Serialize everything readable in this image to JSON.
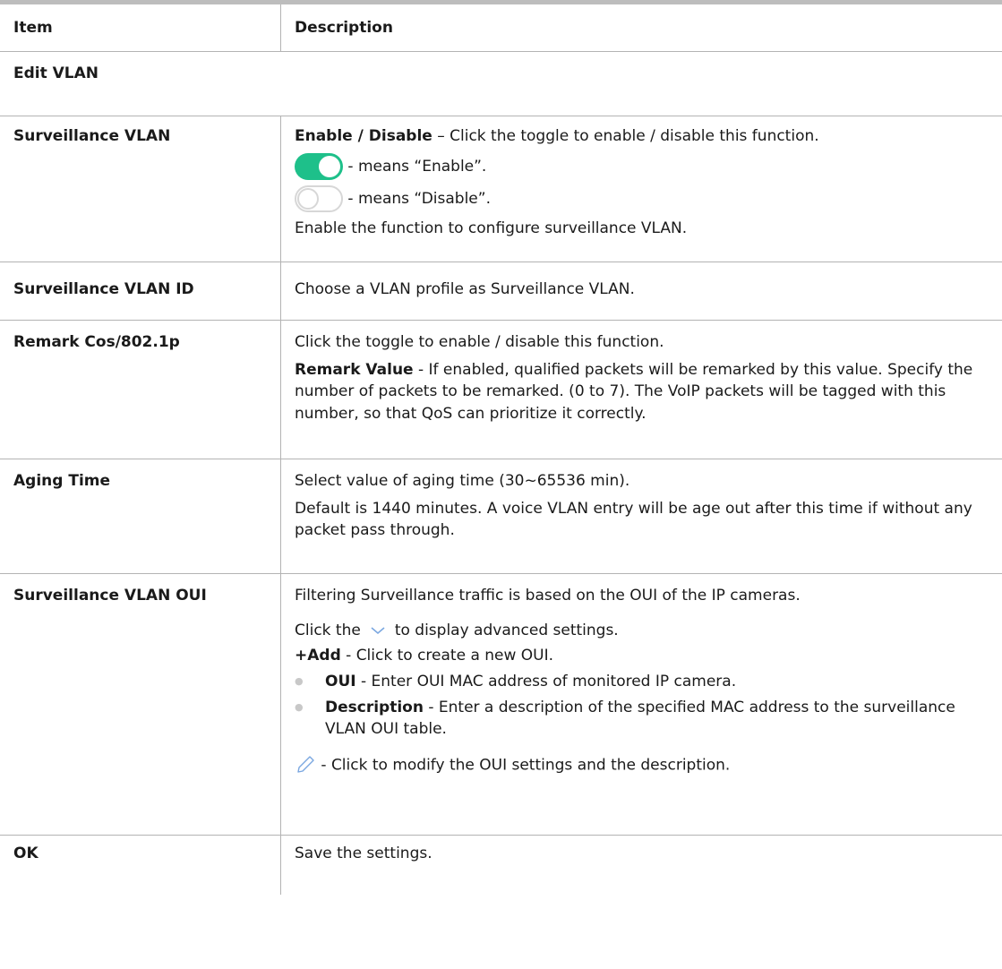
{
  "header": {
    "item": "Item",
    "description": "Description"
  },
  "section": {
    "title": "Edit VLAN"
  },
  "rows": {
    "surveillance_vlan": {
      "item": "Surveillance VLAN",
      "line1_bold": "Enable / Disable",
      "line1_rest": " – Click the toggle to enable / disable this function.",
      "enable_text": " - means “Enable”.",
      "disable_text": " - means “Disable”.",
      "line4": "Enable the function to configure surveillance VLAN."
    },
    "surveillance_vlan_id": {
      "item": "Surveillance VLAN ID",
      "text": "Choose a VLAN profile as Surveillance VLAN."
    },
    "remark": {
      "item": "Remark Cos/802.1p",
      "line1": "Click the toggle to enable / disable this function.",
      "bold": "Remark Value",
      "rest": " - If enabled, qualified packets will be remarked by this value. Specify the number of packets to be remarked. (0 to 7). The VoIP packets will be tagged with this number, so that QoS can prioritize it correctly."
    },
    "aging_time": {
      "item": "Aging Time",
      "line1": "Select value of aging time (30~65536 min).",
      "line2": "Default is 1440 minutes. A voice VLAN entry will be age out after this time if without any packet pass through."
    },
    "oui": {
      "item": "Surveillance VLAN OUI",
      "line1": "Filtering Surveillance traffic is based on the OUI of the IP cameras.",
      "line2_pre": "Click the",
      "line2_post": "to display advanced settings.",
      "add_bold": "+Add",
      "add_rest": " - Click to create a new OUI.",
      "bullet_mark": "●",
      "b1_bold": "OUI",
      "b1_rest": " - Enter OUI MAC address of monitored IP camera.",
      "b2_bold": "Description",
      "b2_rest": " - Enter a description of the specified MAC address to the surveillance VLAN OUI table.",
      "pencil_text": " - Click to modify the OUI settings and the description."
    },
    "ok": {
      "item": "OK",
      "text": "Save the settings."
    }
  },
  "colors": {
    "toggle_on": "#1ec08a",
    "toggle_off_border": "#d7d7d7",
    "rule": "#b3b3b3"
  },
  "icons": {
    "toggle_on": "toggle-on-icon",
    "toggle_off": "toggle-off-icon",
    "chevron": "chevron-down-icon",
    "pencil": "pencil-icon"
  }
}
